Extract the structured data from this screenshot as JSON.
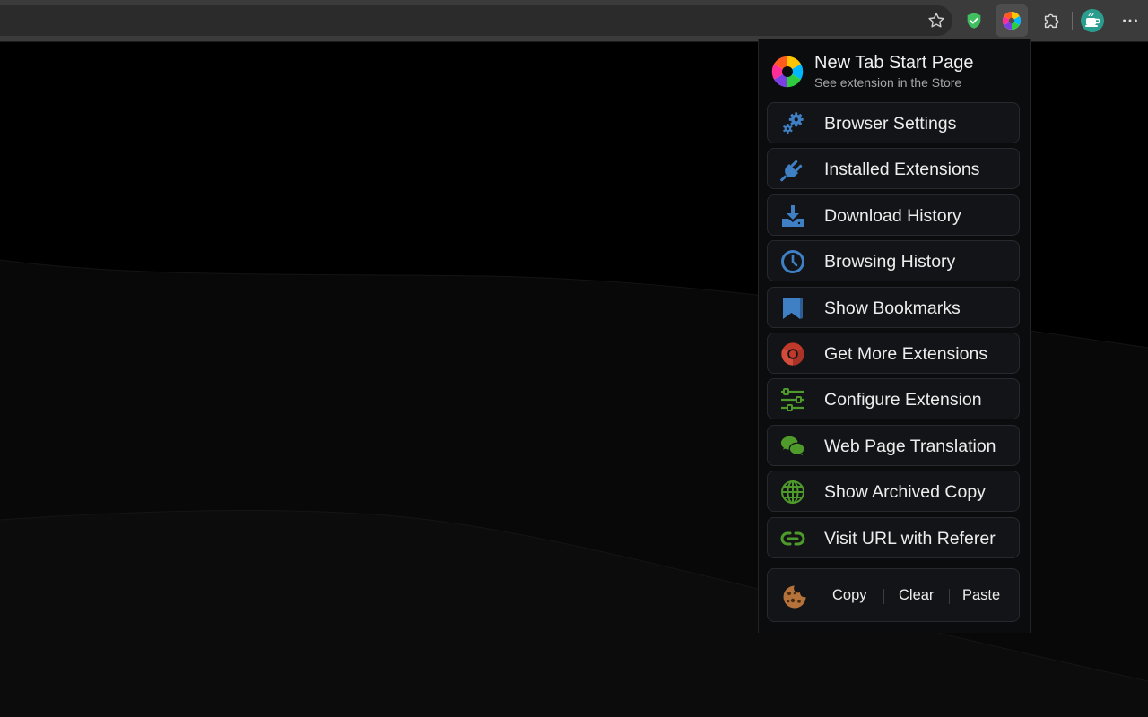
{
  "toolbar": {
    "icons": [
      "star-icon",
      "shield-icon",
      "new-tab-start-page-icon",
      "puzzle-icon",
      "profile-avatar",
      "more-icon"
    ],
    "colors": {
      "toolbar_bg": "#3b3b3b",
      "address_bar_bg": "#2b2b2b",
      "shield": "#3fbf5f"
    }
  },
  "popup": {
    "title": "New Tab Start Page",
    "subtitle": "See extension in the Store",
    "items": [
      {
        "label": "Browser Settings",
        "icon": "gears-icon",
        "color": "#3f7fc4"
      },
      {
        "label": "Installed Extensions",
        "icon": "plug-icon",
        "color": "#3f7fc4"
      },
      {
        "label": "Download History",
        "icon": "download-icon",
        "color": "#3f7fc4"
      },
      {
        "label": "Browsing History",
        "icon": "clock-icon",
        "color": "#3f7fc4"
      },
      {
        "label": "Show Bookmarks",
        "icon": "bookmark-icon",
        "color": "#3f7fc4"
      },
      {
        "label": "Get More Extensions",
        "icon": "chrome-icon",
        "color": "#c0392b"
      },
      {
        "label": "Configure Extension",
        "icon": "sliders-icon",
        "color": "#4e9a2a"
      },
      {
        "label": "Web Page Translation",
        "icon": "chat-icon",
        "color": "#4e9a2a"
      },
      {
        "label": "Show Archived Copy",
        "icon": "globe-icon",
        "color": "#4e9a2a"
      },
      {
        "label": "Visit URL with Referer",
        "icon": "link-icon",
        "color": "#4e9a2a"
      }
    ],
    "cookies": {
      "icon": "cookie-icon",
      "copy": "Copy",
      "clear": "Clear",
      "paste": "Paste"
    }
  }
}
